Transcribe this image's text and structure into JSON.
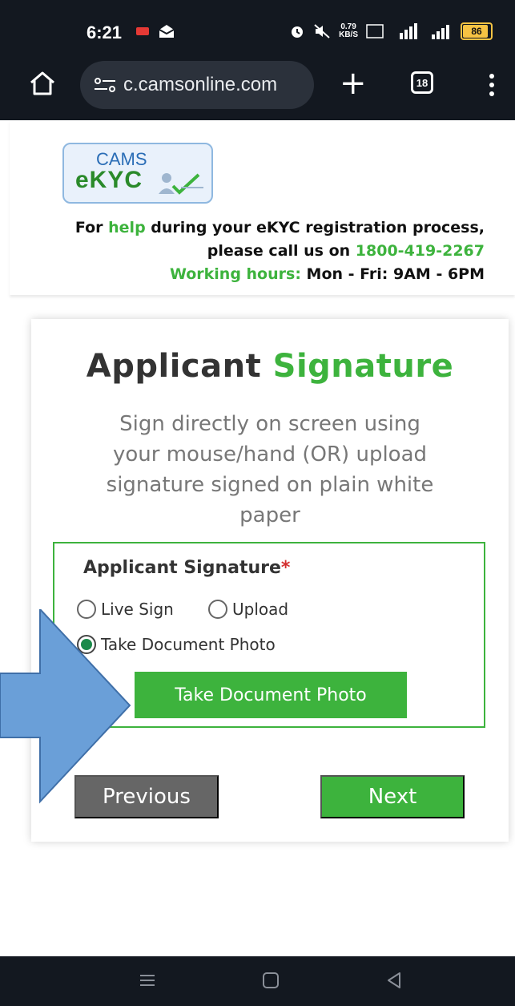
{
  "status_bar": {
    "time": "6:21",
    "speed_top": "0.79",
    "speed_bottom": "KB/S",
    "battery": "86"
  },
  "browser": {
    "url": "c.camsonline.com",
    "tab_count": "18"
  },
  "header": {
    "logo_top": "CAMS",
    "logo_bottom": "eKYC",
    "help_prefix": "For ",
    "help_word": "help",
    "help_rest": " during your eKYC registration process,",
    "call_text": "please call us on ",
    "phone": "1800-419-2267",
    "hours_label": "Working hours:",
    "hours_value": " Mon - Fri: 9AM - 6PM"
  },
  "card": {
    "title_part1": "Applicant ",
    "title_part2": "Signature",
    "subtitle": "Sign directly on screen using your mouse/hand (OR) upload signature signed on plain white paper",
    "field_label": "Applicant Signature",
    "required_mark": "*",
    "options": [
      {
        "label": "Live Sign",
        "selected": false
      },
      {
        "label": "Upload",
        "selected": false
      },
      {
        "label": "Take Document Photo",
        "selected": true
      }
    ],
    "action_button": "Take Document Photo",
    "previous_button": "Previous",
    "next_button": "Next"
  },
  "colors": {
    "accent_green": "#3db33d",
    "dark_bar": "#131820",
    "arrow_blue": "#6a9fd8"
  }
}
